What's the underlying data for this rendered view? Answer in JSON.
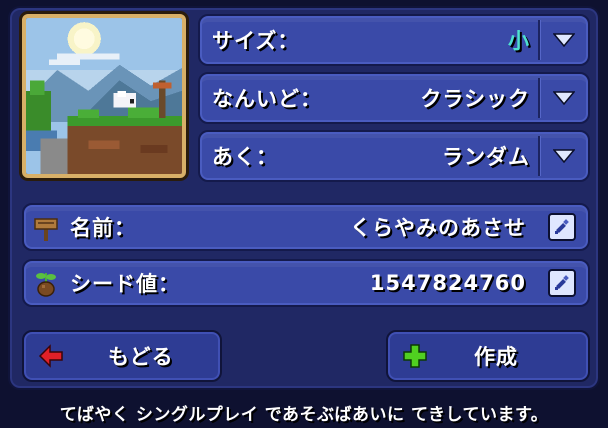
{
  "world_settings": {
    "size": {
      "label": "サイズ：",
      "value": "小",
      "value_color": "#4ee0d0"
    },
    "difficulty": {
      "label": "なんいど：",
      "value": "クラシック",
      "value_color": "#ffffff"
    },
    "evil": {
      "label": "あく：",
      "value": "ランダム",
      "value_color": "#ffffff"
    }
  },
  "world_name": {
    "label": "名前：",
    "value": "くらやみのあさせ",
    "icon": "signpost-icon"
  },
  "seed": {
    "label": "シード値：",
    "value": "1547824760",
    "icon": "acorn-sprout-icon"
  },
  "buttons": {
    "back_label": "もどる",
    "create_label": "作成"
  },
  "status_text": "てばやく シングルプレイ であそぶばあいに てきしています。",
  "colors": {
    "panel": "#202864",
    "field": "#3a4aa8",
    "back_arrow": "#e02028",
    "create_plus": "#50d020"
  }
}
